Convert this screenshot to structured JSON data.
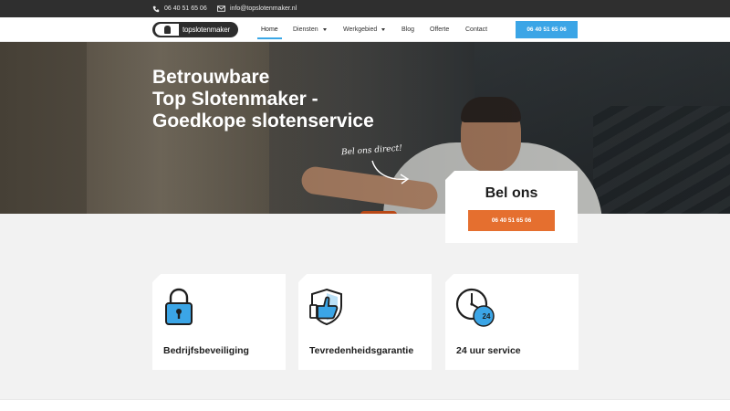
{
  "topbar": {
    "phone": "06 40 51 65 06",
    "email": "info@topslotenmaker.nl",
    "phone_icon": "phone-icon",
    "email_icon": "envelope-icon"
  },
  "logo": {
    "text_top": "top",
    "text_rest": "slotenmaker"
  },
  "nav": {
    "items": [
      {
        "label": "Home",
        "active": true
      },
      {
        "label": "Diensten",
        "dropdown": true
      },
      {
        "label": "Werkgebied",
        "dropdown": true
      },
      {
        "label": "Blog"
      },
      {
        "label": "Offerte"
      },
      {
        "label": "Contact"
      }
    ],
    "cta_label": "06 40 51 65 06"
  },
  "hero": {
    "title_lines": [
      "Betrouwbare",
      "Top Slotenmaker -",
      "Goedkope slotenservice"
    ],
    "handwritten": "Bel ons direct!"
  },
  "call_card": {
    "title": "Bel ons",
    "button_label": "06 40 51 65 06"
  },
  "features": [
    {
      "label": "Bedrijfsbeveiliging",
      "icon": "padlock-icon"
    },
    {
      "label": "Tevredenheidsgarantie",
      "icon": "shield-thumbs-up-icon"
    },
    {
      "label": "24 uur service",
      "icon": "clock-24-icon",
      "badge": "24"
    }
  ],
  "colors": {
    "accent_blue": "#3ba5e6",
    "accent_orange": "#e56f2f",
    "topbar_bg": "#2f2f2f"
  }
}
